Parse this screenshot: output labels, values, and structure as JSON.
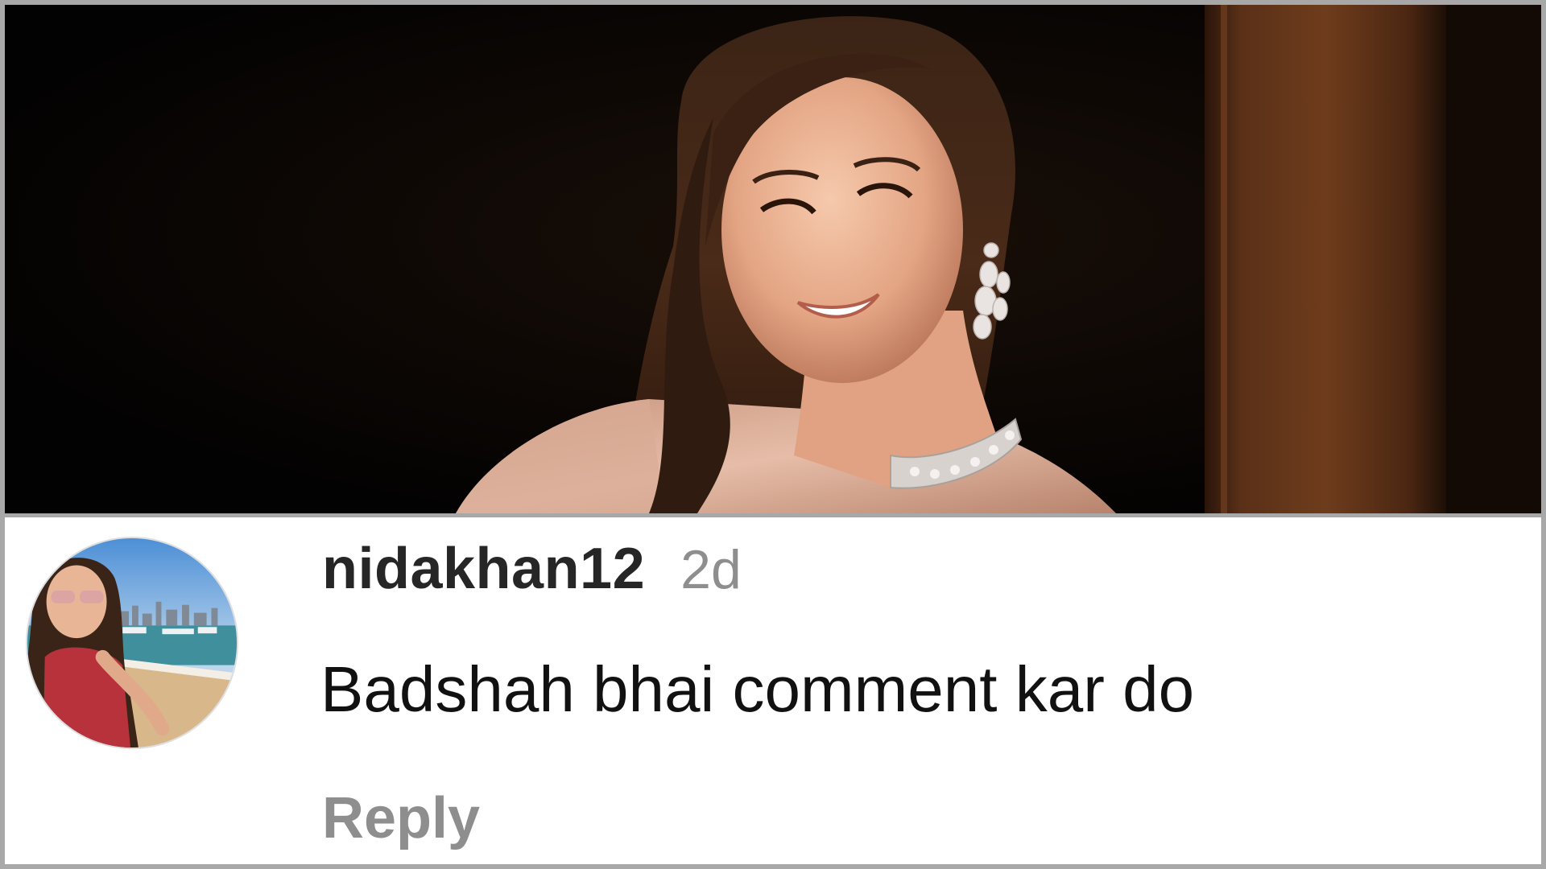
{
  "post": {
    "image_alt": "Smiling woman in embellished outfit with diamond earrings and choker"
  },
  "comment": {
    "username": "nidakhan12",
    "timestamp": "2d",
    "text": "Badshah bhai comment kar do",
    "reply_label": "Reply",
    "avatar_alt": "nidakhan12 profile picture"
  },
  "colors": {
    "frame_border": "#a8a8a8",
    "username": "#262626",
    "secondary_text": "#8e8e8e",
    "comment_text": "#111111",
    "background": "#ffffff"
  }
}
